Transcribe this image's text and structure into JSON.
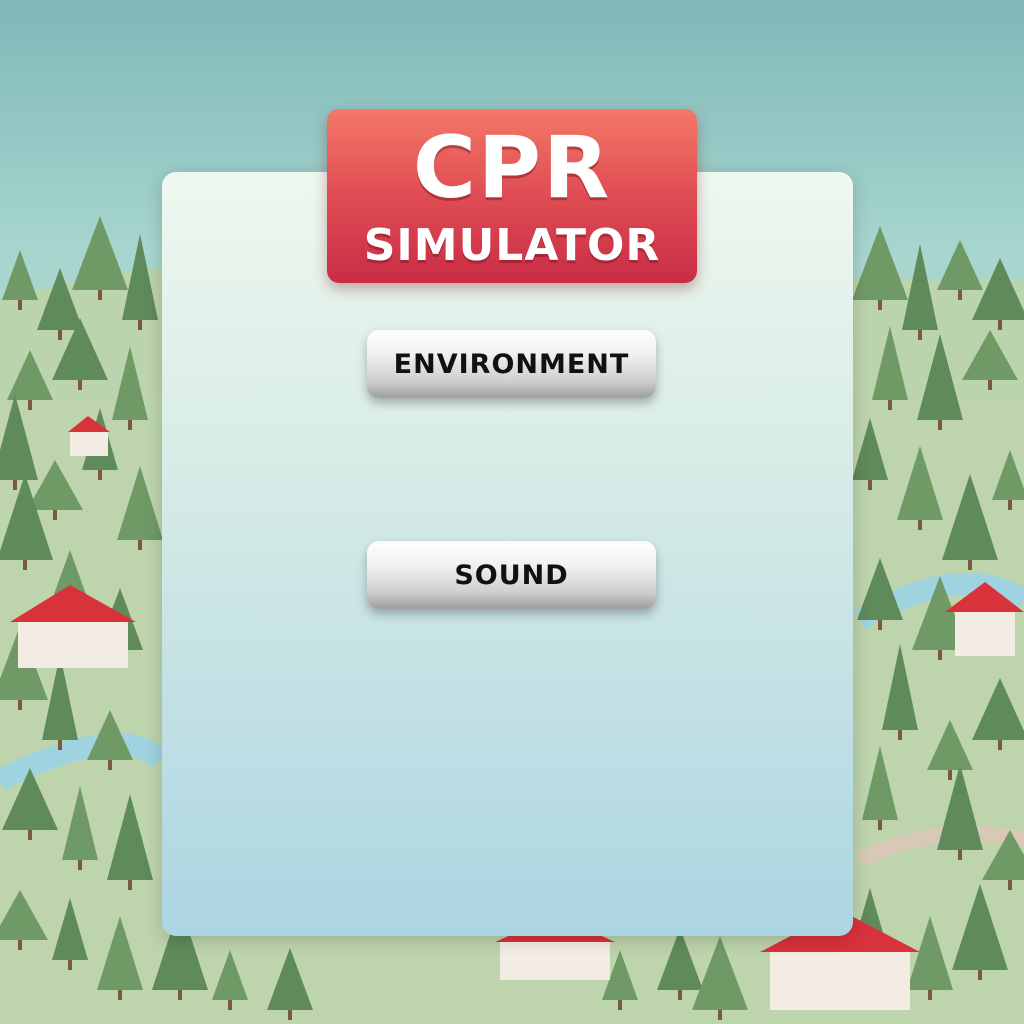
{
  "title": {
    "main": "CPR",
    "sub": "SIMULATOR"
  },
  "menu": {
    "environment_label": "ENVIRONMENT",
    "sound_label": "SOUND"
  },
  "colors": {
    "banner_top": "#f47868",
    "banner_bottom": "#c92c45",
    "panel_top": "#eef8ef",
    "panel_bottom": "#acd5e2",
    "button_light": "#ffffff",
    "button_dark": "#9d9d9d"
  },
  "background": {
    "scene": "isometric forest village with pine trees, red-roofed houses and paths"
  }
}
